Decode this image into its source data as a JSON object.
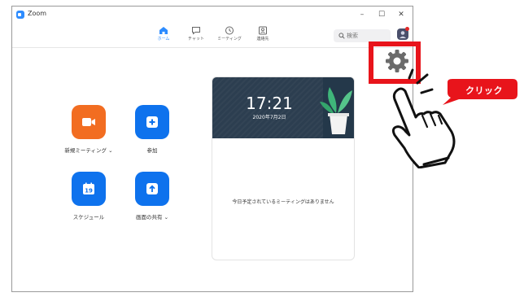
{
  "window": {
    "title": "Zoom",
    "controls": {
      "minimize": "–",
      "maximize": "☐",
      "close": "✕"
    }
  },
  "nav": {
    "tabs": [
      {
        "label": "ホーム",
        "icon": "home-icon",
        "active": true
      },
      {
        "label": "チャット",
        "icon": "chat-icon",
        "active": false
      },
      {
        "label": "ミーティング",
        "icon": "clock-icon",
        "active": false
      },
      {
        "label": "連絡先",
        "icon": "contacts-icon",
        "active": false
      }
    ],
    "search": {
      "placeholder": "検索"
    }
  },
  "actions": [
    {
      "label": "新規ミーティング",
      "dropdown": "⌄",
      "color": "#f26d21",
      "icon": "video-camera-icon"
    },
    {
      "label": "参加",
      "color": "#0e72ed",
      "icon": "plus-icon"
    },
    {
      "label": "スケジュール",
      "color": "#0e72ed",
      "icon": "calendar-icon",
      "calendar_day": "19"
    },
    {
      "label": "画面の共有",
      "dropdown": "⌄",
      "color": "#0e72ed",
      "icon": "share-screen-icon"
    }
  ],
  "card": {
    "time": "17:21",
    "date": "2020年7月2日",
    "empty_message": "今日予定されているミーティングはありません"
  },
  "annotation": {
    "click_text": "クリック",
    "highlight_color": "#e8141b"
  }
}
